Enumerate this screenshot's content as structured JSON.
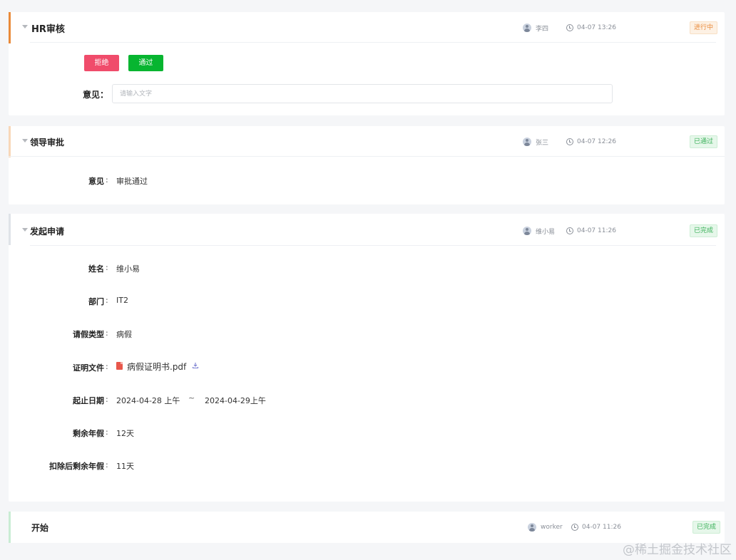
{
  "colors": {
    "accent_in_progress": "#e98a3a",
    "accent_approved": "#f8d7b8",
    "accent_applied": "#dfe3e8",
    "accent_start": "#c9ecd4",
    "reject_button": "#f04c6b",
    "pass_button": "#07b530"
  },
  "hr_review": {
    "title": "HR审核",
    "user": "李四",
    "time": "04-07 13:26",
    "status": "进行中",
    "reject_label": "拒绝",
    "pass_label": "通过",
    "opinion_label": "意见：",
    "opinion_placeholder": "请输入文字",
    "opinion_value": ""
  },
  "leader_approval": {
    "title": "领导审批",
    "user": "张三",
    "time": "04-07 12:26",
    "status": "已通过",
    "opinion_label": "意见",
    "opinion_value": "审批通过"
  },
  "application": {
    "title": "发起申请",
    "user": "维小易",
    "time": "04-07 11:26",
    "status": "已完成",
    "fields": {
      "name": {
        "label": "姓名",
        "value": "维小易"
      },
      "department": {
        "label": "部门",
        "value": "IT2"
      },
      "leave_type": {
        "label": "请假类型",
        "value": "病假"
      },
      "proof_file": {
        "label": "证明文件",
        "value": "病假证明书.pdf"
      },
      "date_range": {
        "label": "起止日期",
        "start": "2024-04-28 上午",
        "separator": "~",
        "end": "2024-04-29上午"
      },
      "remaining_leave": {
        "label": "剩余年假",
        "value": "12天"
      },
      "remaining_after": {
        "label": "扣除后剩余年假",
        "value": "11天"
      }
    }
  },
  "start": {
    "title": "开始",
    "user": "worker",
    "time": "04-07 11:26",
    "status": "已完成"
  },
  "watermark": "@稀土掘金技术社区",
  "icons": [
    "caret-down-icon",
    "avatar-icon",
    "clock-icon",
    "pdf-file-icon",
    "download-icon"
  ]
}
